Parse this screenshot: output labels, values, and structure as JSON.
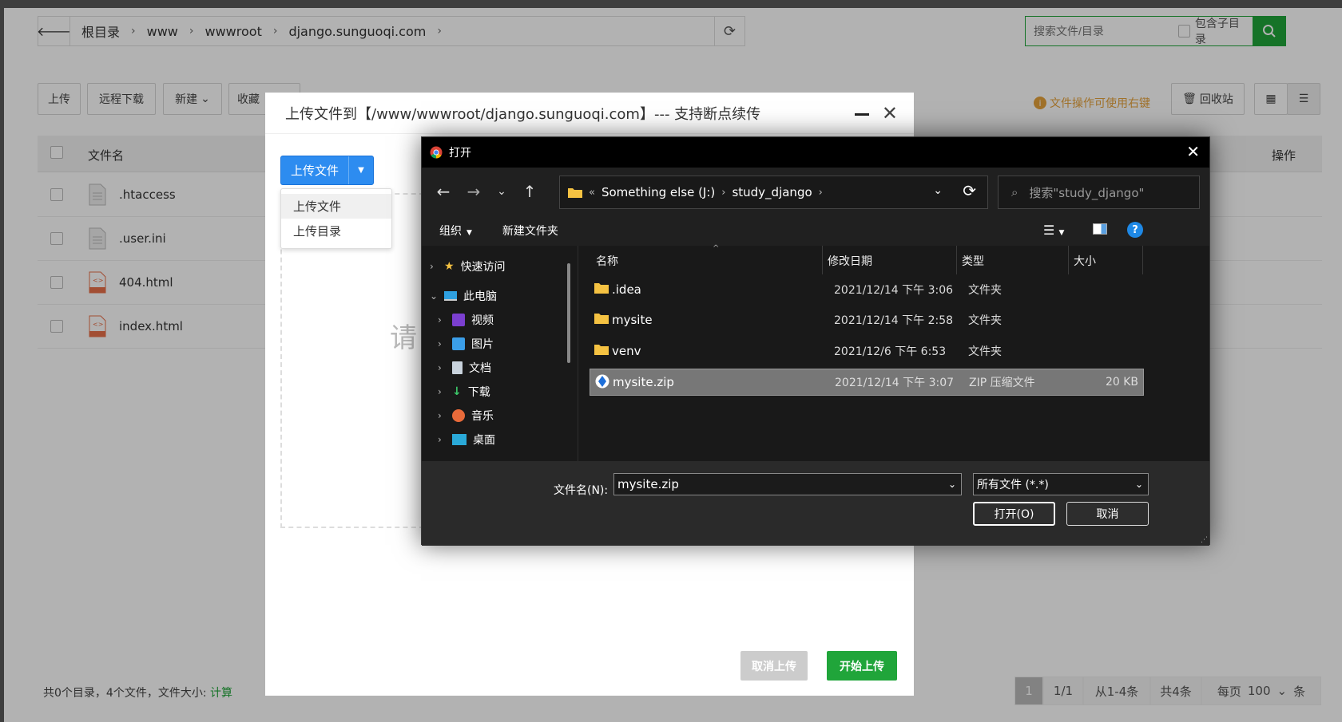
{
  "breadcrumb": {
    "items": [
      "根目录",
      "www",
      "wwwroot",
      "django.sunguoqi.com"
    ]
  },
  "search": {
    "placeholder": "搜索文件/目录",
    "include_sub": "包含子目录"
  },
  "toolbar": {
    "upload": "上传",
    "remote_download": "远程下载",
    "new": "新建",
    "favorites": "收藏",
    "tip": "文件操作可使用右键",
    "recycle": "回收站"
  },
  "table": {
    "col_name": "文件名",
    "col_ops": "操作",
    "rows": [
      ".htaccess",
      ".user.ini",
      "404.html",
      "index.html"
    ]
  },
  "footer": {
    "summary": "共0个目录，4个文件，文件大小:",
    "calc": "计算"
  },
  "pager": {
    "current": "1",
    "pages": "1/1",
    "range": "从1-4条",
    "total": "共4条",
    "per_page_label": "每页",
    "per_page": "100",
    "unit": "条"
  },
  "upload_modal": {
    "title": "上传文件到【/www/wwwroot/django.sunguoqi.com】--- 支持断点续传",
    "upload_btn": "上传文件",
    "menu": [
      "上传文件",
      "上传目录"
    ],
    "drop_hint_char": "请",
    "cancel": "取消上传",
    "start": "开始上传"
  },
  "open_dialog": {
    "title": "打开",
    "path": [
      "Something else (J:)",
      "study_django"
    ],
    "search_placeholder": "搜索\"study_django\"",
    "organize": "组织",
    "new_folder": "新建文件夹",
    "nav": {
      "quick_access": "快速访问",
      "this_pc": "此电脑",
      "items": [
        "视频",
        "图片",
        "文档",
        "下载",
        "音乐",
        "桌面"
      ]
    },
    "columns": {
      "name": "名称",
      "date": "修改日期",
      "type": "类型",
      "size": "大小"
    },
    "files": [
      {
        "name": ".idea",
        "date": "2021/12/14 下午 3:06",
        "type": "文件夹",
        "size": ""
      },
      {
        "name": "mysite",
        "date": "2021/12/14 下午 2:58",
        "type": "文件夹",
        "size": ""
      },
      {
        "name": "venv",
        "date": "2021/12/6 下午 6:53",
        "type": "文件夹",
        "size": ""
      },
      {
        "name": "mysite.zip",
        "date": "2021/12/14 下午 3:07",
        "type": "ZIP 压缩文件",
        "size": "20 KB"
      }
    ],
    "filename_label": "文件名(N):",
    "filename_value": "mysite.zip",
    "filetype": "所有文件 (*.*)",
    "open_btn": "打开(O)",
    "cancel_btn": "取消"
  }
}
